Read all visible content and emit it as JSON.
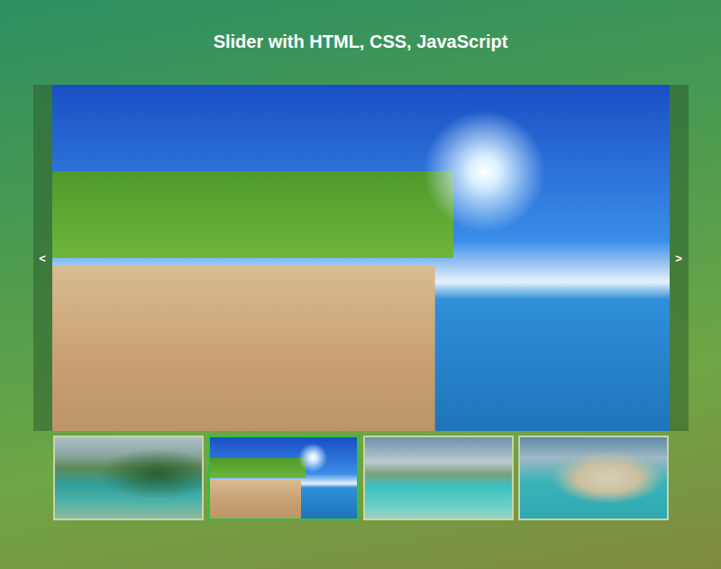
{
  "page": {
    "title": "Slider with HTML, CSS, JavaScript"
  },
  "slider": {
    "prev_button": "<",
    "next_button": ">",
    "slides": [
      {
        "selected": false
      },
      {
        "selected": true
      },
      {
        "selected": false
      },
      {
        "selected": false
      }
    ]
  }
}
